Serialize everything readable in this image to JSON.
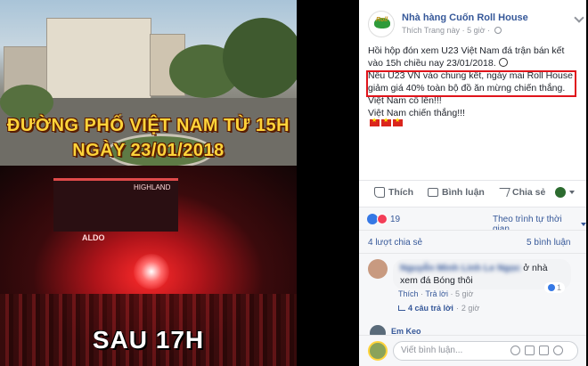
{
  "photo": {
    "caption_line1": "ĐƯỜNG PHỐ VIỆT NAM TỪ 15H",
    "caption_line2": "NGÀY 23/01/2018",
    "caption_bottom": "SAU 17H",
    "sign_aldo": "ALDO",
    "sign_highland": "HIGHLAND"
  },
  "post": {
    "page_name": "Nhà hàng Cuốn Roll House",
    "avatar_text": "Roll",
    "like_page": "Thích Trang này",
    "time": "5 giờ",
    "lines": [
      "Hồi hộp đón xem U23 Việt Nam đá trận bán kết",
      "vào 15h chiều nay 23/01/2018.",
      "Nếu U23 VN vào chung kết, ngày mai Roll House",
      "giảm giá 40% toàn bộ đồ ăn mừng chiến thắng.",
      "Việt Nam cố lên!!!",
      "Việt Nam chiến thắng!!!"
    ]
  },
  "actions": {
    "like": "Thích",
    "comment": "Bình luận",
    "share": "Chia sẻ"
  },
  "reactions": {
    "count": "19",
    "sort_label": "Theo trình tự thời gian"
  },
  "stats": {
    "shares": "4 lượt chia sẻ",
    "views": "5 bình luận"
  },
  "comments": {
    "first": {
      "name": "Nguyễn Minh Linh Le Ngọc",
      "text": "ở nhà xem đá Bóng thôi",
      "like_count": "1",
      "like_action": "Thích",
      "reply_action": "Trả lời",
      "time": "5 giờ",
      "replies": "4 câu trả lời",
      "replies_time": "2 giờ"
    },
    "second": {
      "name": "Em Keo"
    }
  },
  "composer": {
    "placeholder": "Viết bình luận..."
  }
}
